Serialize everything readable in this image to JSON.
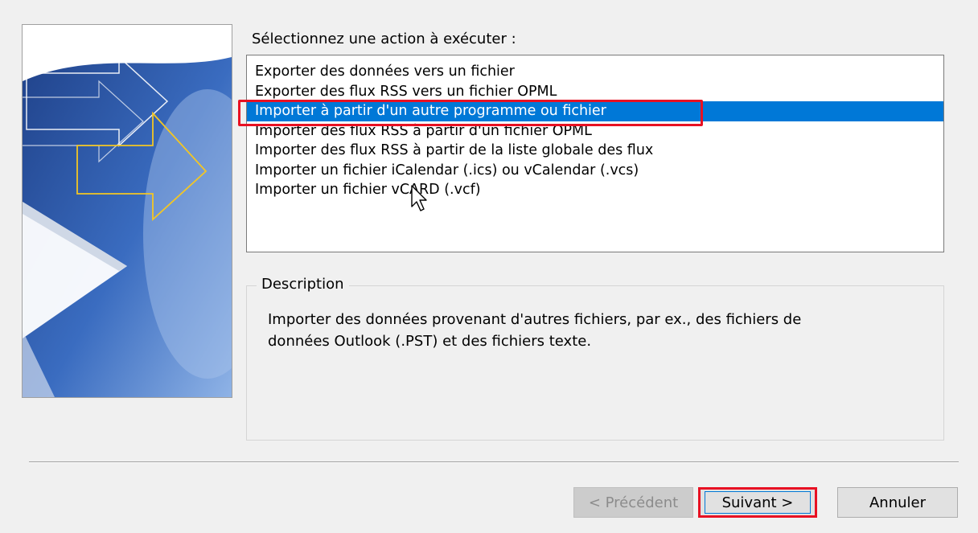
{
  "dialog": {
    "prompt": "Sélectionnez une action à exécuter :",
    "actions": [
      {
        "label": "Exporter des données vers un fichier",
        "selected": false
      },
      {
        "label": "Exporter des flux RSS vers un fichier OPML",
        "selected": false
      },
      {
        "label": "Importer à partir d'un autre programme ou fichier",
        "selected": true
      },
      {
        "label": "Importer des flux RSS à partir d'un fichier OPML",
        "selected": false
      },
      {
        "label": "Importer des flux RSS à partir de la liste globale des flux",
        "selected": false
      },
      {
        "label": "Importer un fichier iCalendar (.ics) ou vCalendar (.vcs)",
        "selected": false
      },
      {
        "label": "Importer un fichier vCARD (.vcf)",
        "selected": false
      }
    ],
    "description": {
      "legend": "Description",
      "text_line1": "Importer des données provenant d'autres fichiers, par ex., des fichiers de",
      "text_line2": "données Outlook (.PST) et des fichiers texte."
    },
    "buttons": {
      "previous": "< Précédent",
      "next": "Suivant >",
      "cancel": "Annuler"
    },
    "colors": {
      "selection": "#0078d7",
      "highlight": "#e81123",
      "banner_blue": "#2f5ea8",
      "arrow_yellow": "#f3c623"
    }
  }
}
